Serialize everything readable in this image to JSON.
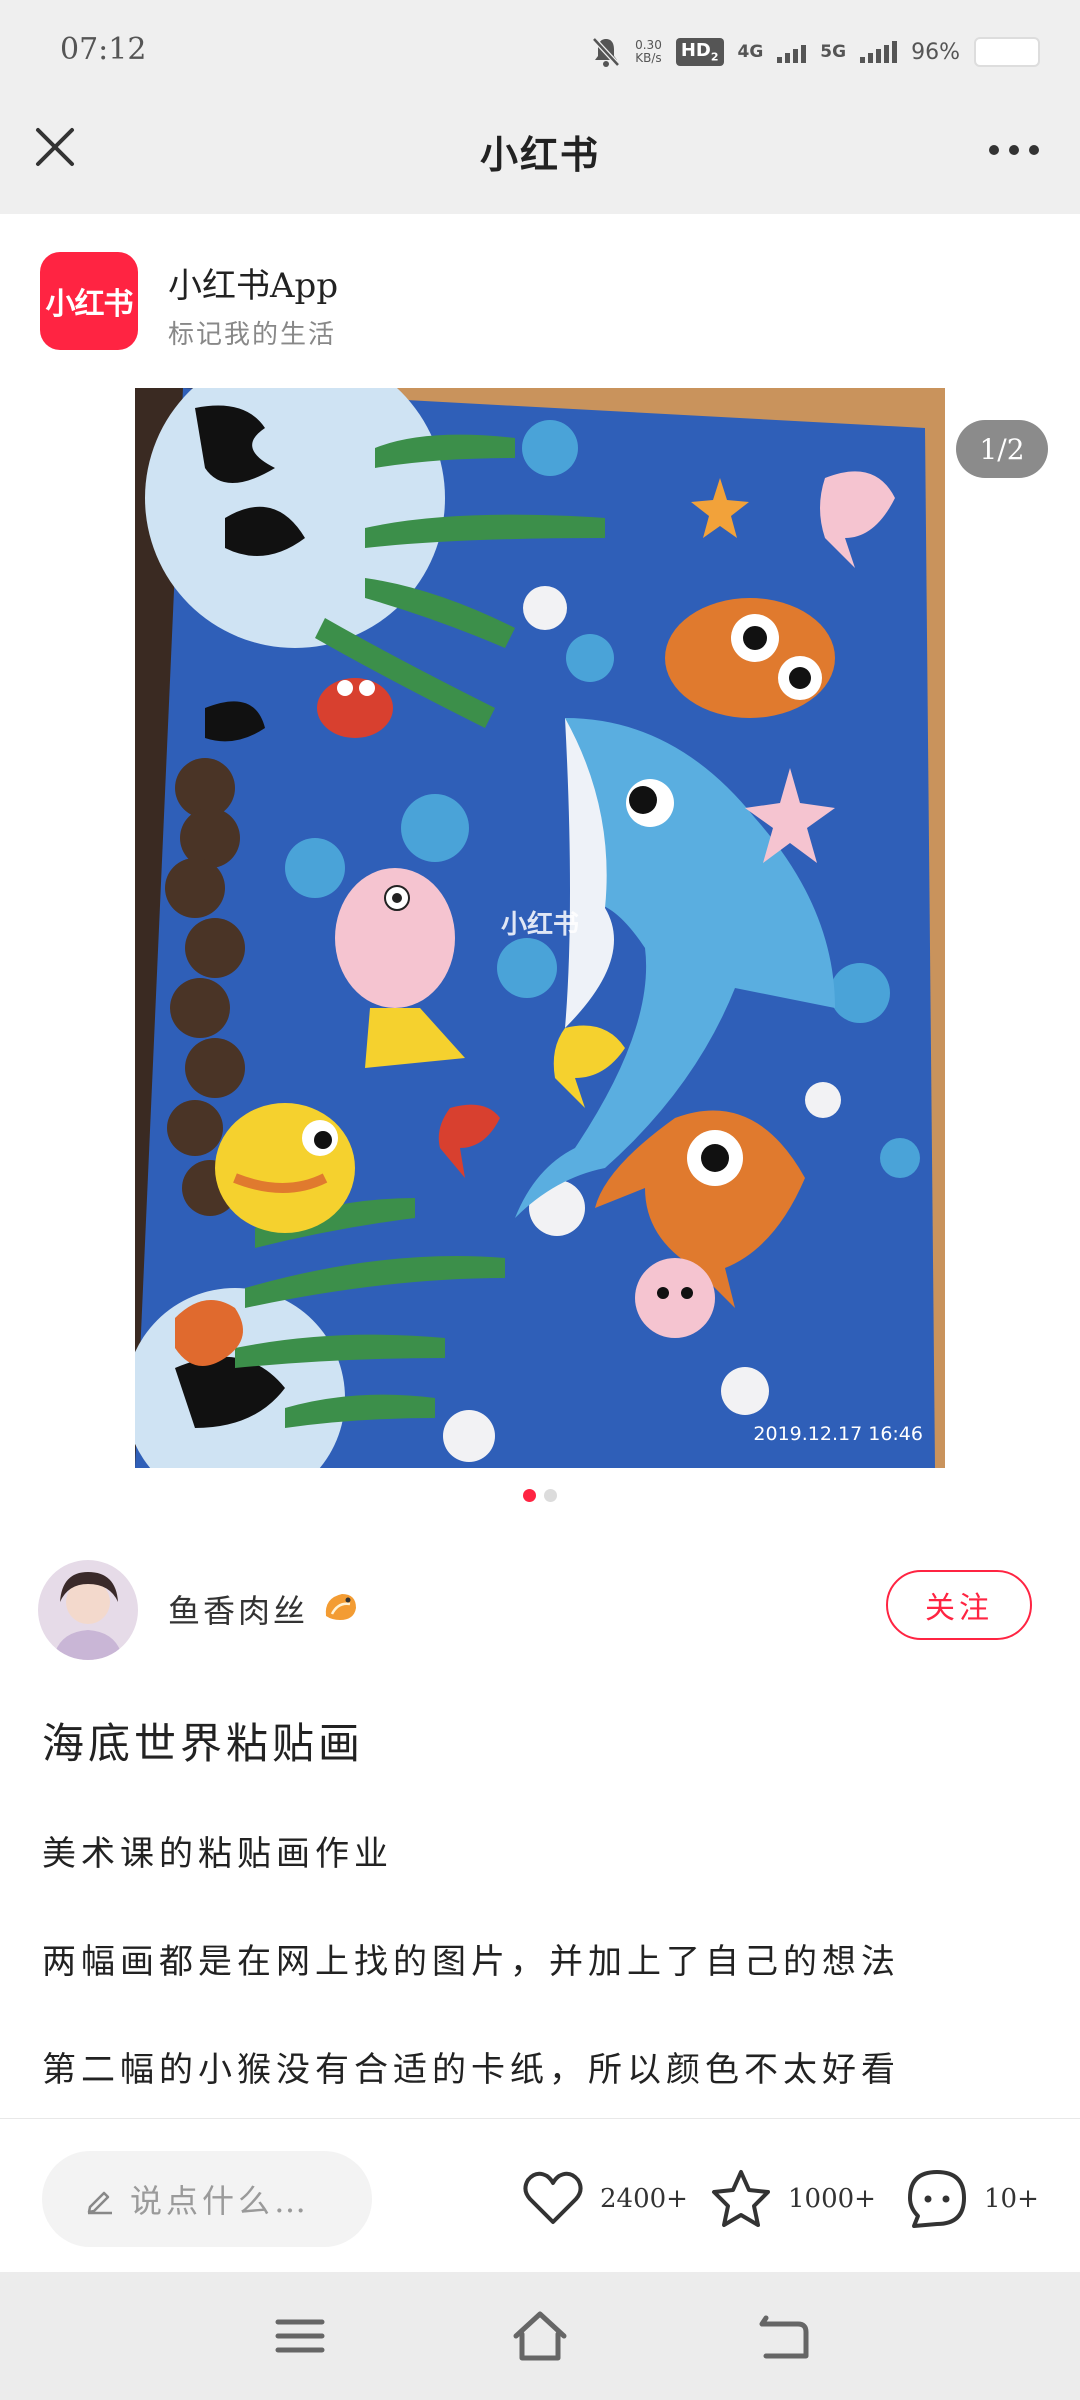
{
  "status_bar": {
    "time": "07:12",
    "speed_value": "0.30",
    "speed_unit": "KB/s",
    "hd_label": "HD",
    "hd_sub": "2",
    "network_1": "4G",
    "network_2": "5G",
    "battery": "96%",
    "icons": [
      "mute-bell-icon",
      "signal-icon",
      "battery-icon"
    ]
  },
  "header": {
    "title": "小红书",
    "close_icon": "close-icon",
    "more_icon": "more-icon"
  },
  "app_banner": {
    "logo_text": "小红书",
    "name": "小红书App",
    "slogan": "标记我的生活"
  },
  "photo": {
    "counter": "1/2",
    "watermark": "小红书",
    "timestamp": "2019.12.17 16:46",
    "page_count": 2,
    "active_page": 1
  },
  "author": {
    "name": "鱼香肉丝",
    "follow_label": "关注"
  },
  "post": {
    "title": "海底世界粘贴画",
    "lines": [
      "美术课的粘贴画作业",
      "两幅画都是在网上找的图片，并加上了自己的想法",
      "第二幅的小猴没有合适的卡纸，所以颜色不太好看"
    ]
  },
  "actions": {
    "comment_placeholder": "说点什么…",
    "likes": "2400+",
    "collects": "1000+",
    "comments": "10+"
  },
  "colors": {
    "brand": "#ff2442",
    "bar_bg": "#efefef",
    "board_blue": "#2f5fb8"
  }
}
